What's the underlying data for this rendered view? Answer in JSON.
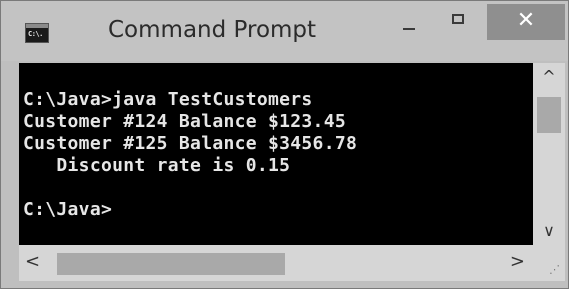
{
  "window": {
    "title": "Command Prompt",
    "icon": "command-prompt-icon",
    "icon_text": "C:\\.",
    "controls": {
      "minimize_icon": "minimize-icon",
      "maximize_icon": "maximize-icon",
      "close_icon": "close-icon",
      "close_glyph": "✕"
    }
  },
  "console": {
    "background": "#000000",
    "text_color": "#e6e6e6",
    "lines": [
      "C:\\Java>java TestCustomers",
      "Customer #124 Balance $123.45",
      "Customer #125 Balance $3456.78",
      "   Discount rate is 0.15",
      "",
      "C:\\Java>"
    ]
  },
  "scrollbars": {
    "up_glyph": "^",
    "down_glyph": "∨",
    "left_glyph": "<",
    "right_glyph": ">",
    "grip_glyph": "⋰"
  }
}
